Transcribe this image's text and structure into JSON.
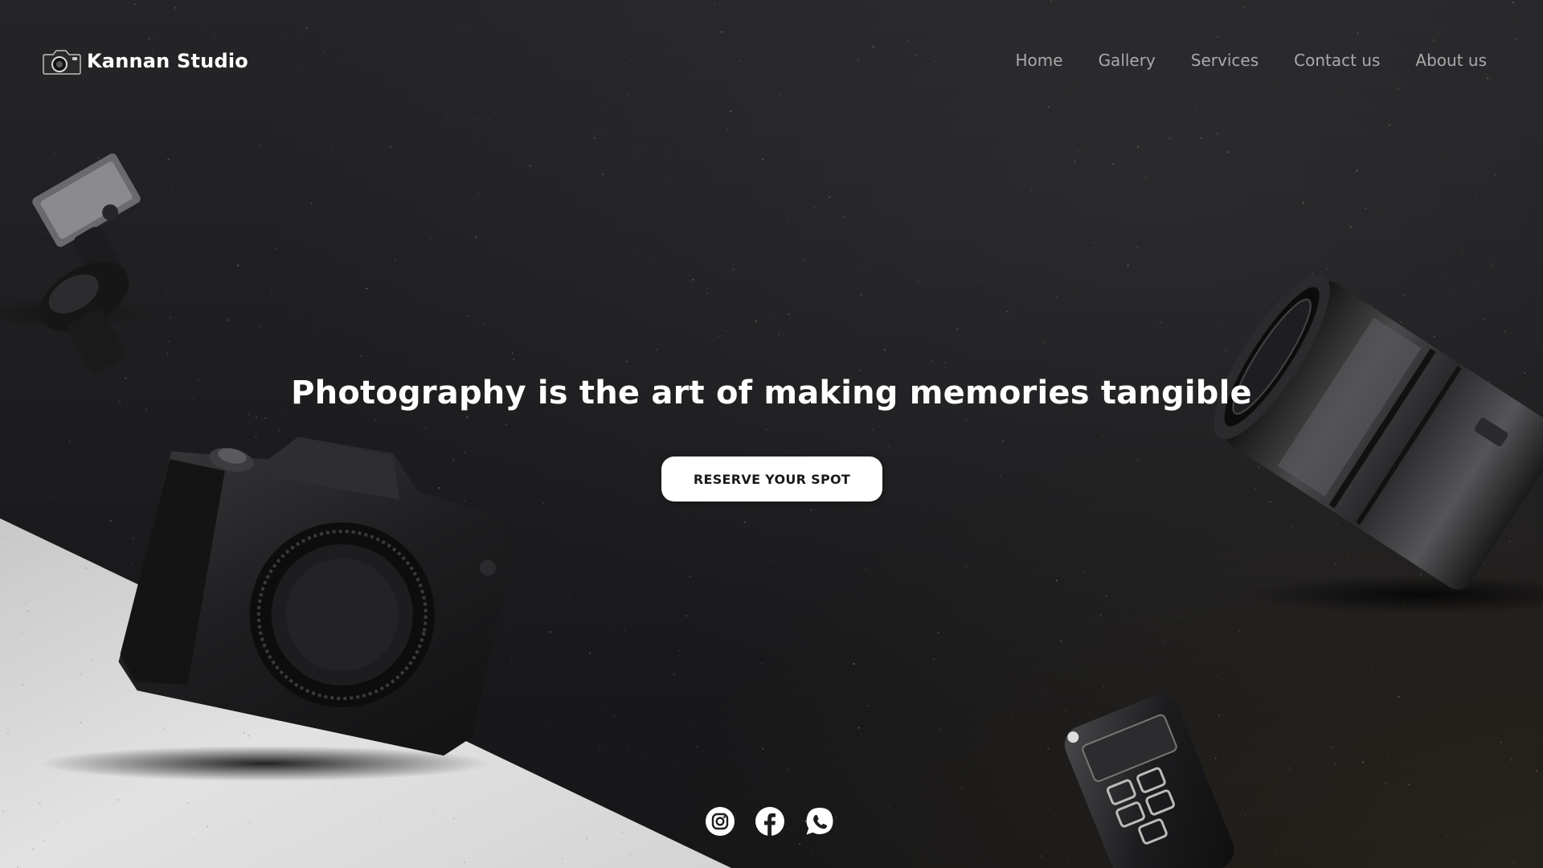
{
  "brand": {
    "name": "Kannan Studio",
    "logo_icon": "camera-icon"
  },
  "nav": {
    "items": [
      {
        "label": "Home"
      },
      {
        "label": "Gallery"
      },
      {
        "label": "Services"
      },
      {
        "label": "Contact us"
      },
      {
        "label": "About us"
      }
    ]
  },
  "hero": {
    "headline": "Photography is the art of making memories tangible",
    "cta_label": "RESERVE YOUR SPOT"
  },
  "socials": {
    "items": [
      {
        "icon": "instagram-icon"
      },
      {
        "icon": "facebook-icon"
      },
      {
        "icon": "whatsapp-icon"
      }
    ]
  },
  "colors": {
    "background": "#1d1d1f",
    "floor": "#dcdcdc",
    "text_primary": "#ffffff",
    "nav_text": "#a9a9ab",
    "button_bg": "#ffffff",
    "button_text": "#1a1a1a"
  }
}
